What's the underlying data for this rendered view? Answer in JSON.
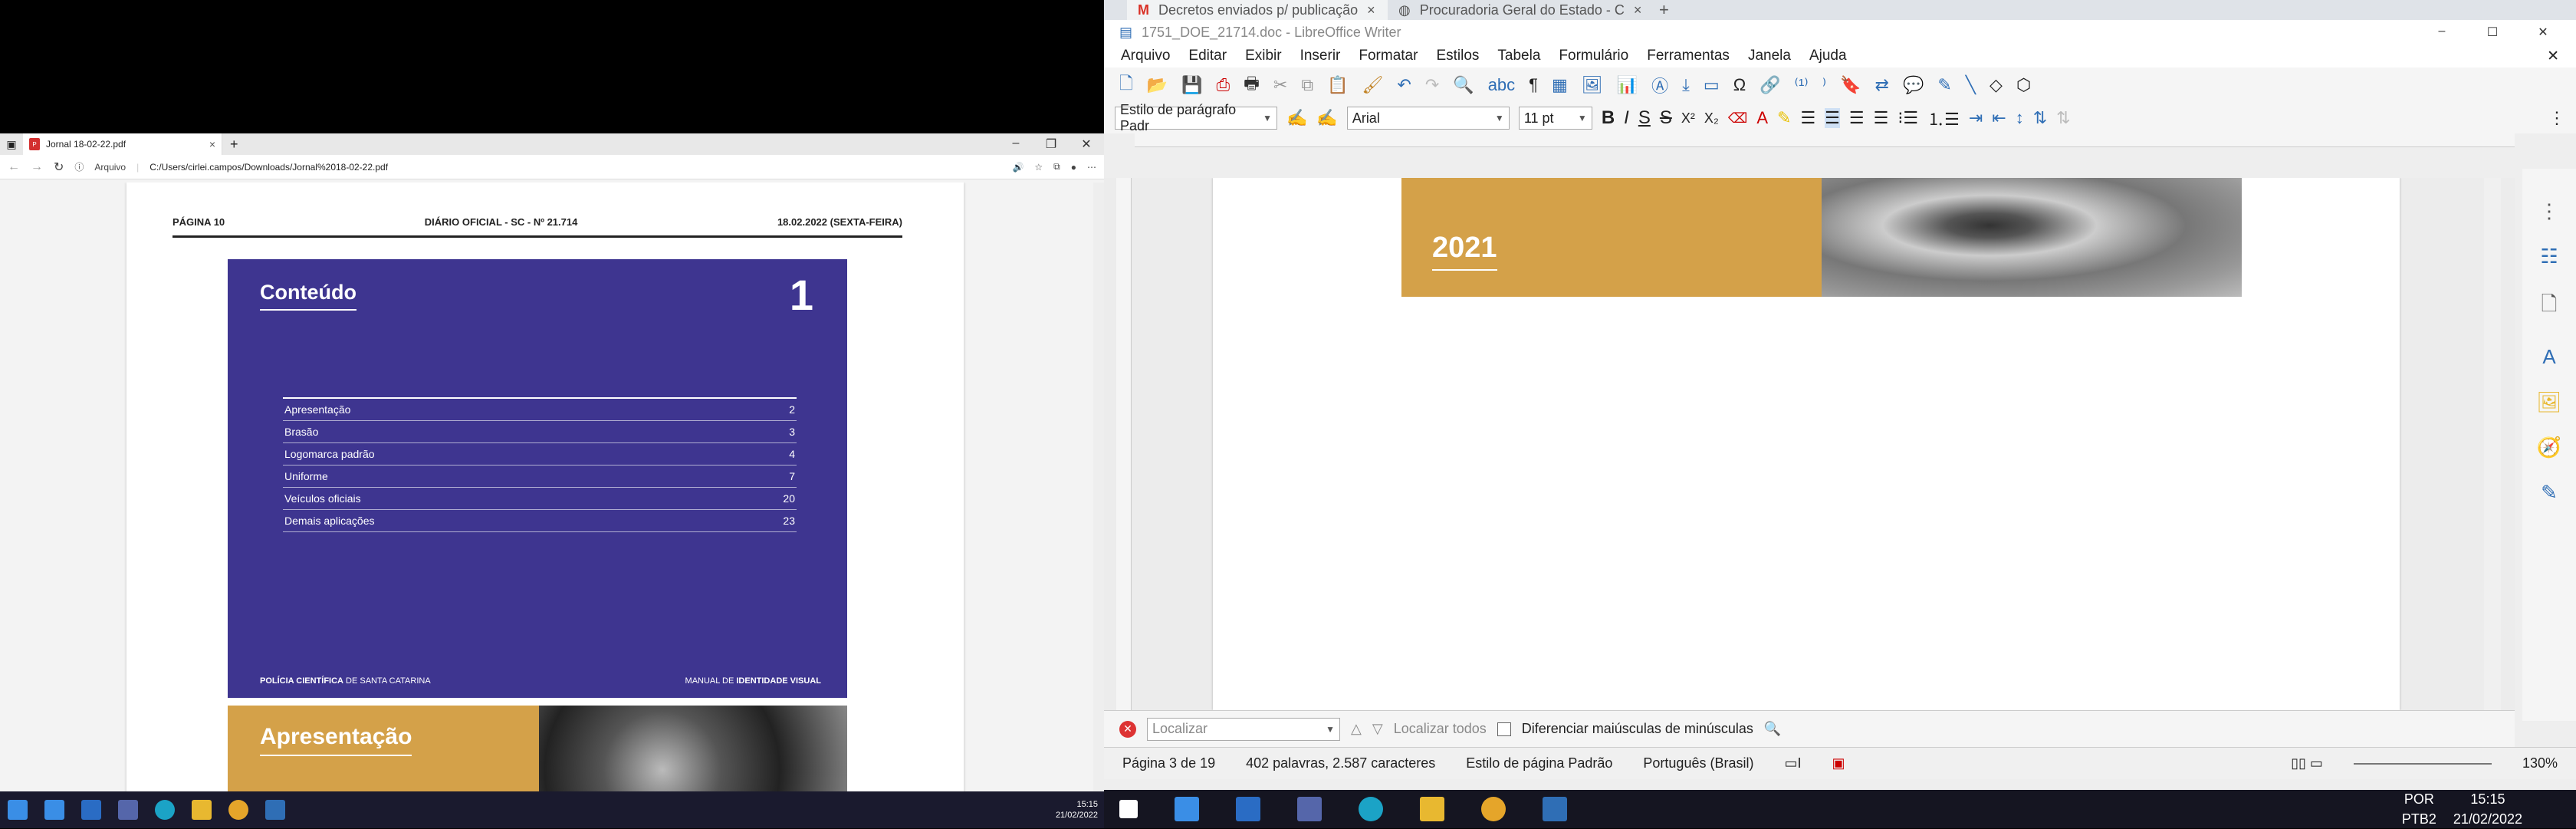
{
  "edge": {
    "tab_title": "Jornal 18-02-22.pdf",
    "address_label": "Arquivo",
    "address_url": "C:/Users/cirlei.campos/Downloads/Jornal%2018-02-22.pdf"
  },
  "pdf": {
    "header_left": "PÁGINA 10",
    "header_center": "DIÁRIO OFICIAL - SC - Nº 21.714",
    "header_right": "18.02.2022 (SEXTA-FEIRA)",
    "section_title": "Conteúdo",
    "section_number": "1",
    "toc": [
      {
        "label": "Apresentação",
        "page": "2"
      },
      {
        "label": "Brasão",
        "page": "3"
      },
      {
        "label": "Logomarca padrão",
        "page": "4"
      },
      {
        "label": "Uniforme",
        "page": "7"
      },
      {
        "label": "Veículos oficiais",
        "page": "20"
      },
      {
        "label": "Demais aplicações",
        "page": "23"
      }
    ],
    "footer_left_bold": "POLÍCIA CIENTÍFICA",
    "footer_left": " DE SANTA CATARINA",
    "footer_right": "MANUAL DE ",
    "footer_right_bold": "IDENTIDADE VISUAL",
    "next_section_title": "Apresentação"
  },
  "taskbar_left": {
    "time": "15:15",
    "date": "21/02/2022"
  },
  "browser_tabs": [
    {
      "label": "Decretos enviados p/ publicação"
    },
    {
      "label": "Procuradoria Geral do Estado - C"
    }
  ],
  "writer": {
    "window_title": "1751_DOE_21714.doc - LibreOffice Writer",
    "menu": [
      "Arquivo",
      "Editar",
      "Exibir",
      "Inserir",
      "Formatar",
      "Estilos",
      "Tabela",
      "Formulário",
      "Ferramentas",
      "Janela",
      "Ajuda"
    ],
    "paragraph_style": "Estilo de parágrafo Padr",
    "font_name": "Arial",
    "font_size": "11 pt",
    "doc_year_label": "2021",
    "find_placeholder": "Localizar",
    "find_all_label": "Localizar todos",
    "match_case_label": "Diferenciar maiúsculas de minúsculas",
    "status_page": "Página 3 de 19",
    "status_words": "402 palavras, 2.587 caracteres",
    "status_page_style": "Estilo de página Padrão",
    "status_language": "Português (Brasil)",
    "zoom": "130%"
  },
  "taskbar_right": {
    "lang1": "POR",
    "lang2": "PTB2",
    "time": "15:15",
    "date": "21/02/2022"
  }
}
